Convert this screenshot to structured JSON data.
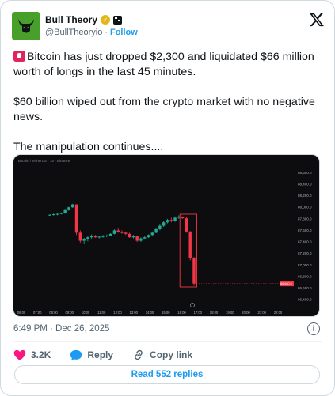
{
  "author": {
    "name": "Bull Theory",
    "handle": "@BullTheoryio",
    "separator": "·",
    "follow_label": "Follow"
  },
  "tweet": {
    "line1": "Bitcoin has just dropped $2,300 and liquidated $66 million worth of longs in the last 45 minutes.",
    "line2": "$60 billion wiped out from the crypto market with no negative news.",
    "line3": "The manipulation continues...."
  },
  "chart_data": {
    "type": "candlestick",
    "y_ticks": [
      "88,600.0",
      "88,400.0",
      "88,200.0",
      "88,000.0",
      "87,800.0",
      "87,600.0",
      "87,400.0",
      "87,200.0",
      "87,000.0",
      "86,800.0",
      "86,600.0",
      "86,400.0"
    ],
    "x_ticks": [
      "06:00",
      "07:00",
      "08:00",
      "09:00",
      "10:00",
      "11:00",
      "12:00",
      "13:00",
      "14:00",
      "15:00",
      "16:00",
      "17:00",
      "18:00",
      "19:00",
      "20:00",
      "21:00",
      "22:00"
    ],
    "candles": [
      [
        87860,
        87880,
        87850,
        87870
      ],
      [
        87870,
        87890,
        87855,
        87880
      ],
      [
        87880,
        87895,
        87860,
        87885
      ],
      [
        87885,
        87910,
        87875,
        87905
      ],
      [
        87905,
        87960,
        87890,
        87950
      ],
      [
        87950,
        88010,
        87940,
        88000
      ],
      [
        88000,
        88060,
        87990,
        88050
      ],
      [
        88050,
        88010,
        87520,
        87560
      ],
      [
        87560,
        87600,
        87380,
        87420
      ],
      [
        87420,
        87470,
        87360,
        87450
      ],
      [
        87450,
        87500,
        87410,
        87480
      ],
      [
        87480,
        87530,
        87450,
        87500
      ],
      [
        87500,
        87520,
        87470,
        87480
      ],
      [
        87480,
        87510,
        87460,
        87490
      ],
      [
        87490,
        87520,
        87470,
        87500
      ],
      [
        87500,
        87530,
        87480,
        87510
      ],
      [
        87510,
        87550,
        87500,
        87540
      ],
      [
        87540,
        87620,
        87530,
        87600
      ],
      [
        87600,
        87640,
        87560,
        87570
      ],
      [
        87570,
        87600,
        87540,
        87560
      ],
      [
        87560,
        87580,
        87520,
        87540
      ],
      [
        87540,
        87560,
        87470,
        87480
      ],
      [
        87480,
        87520,
        87460,
        87500
      ],
      [
        87500,
        87490,
        87400,
        87420
      ],
      [
        87420,
        87480,
        87400,
        87460
      ],
      [
        87460,
        87500,
        87440,
        87480
      ],
      [
        87480,
        87530,
        87470,
        87520
      ],
      [
        87520,
        87580,
        87500,
        87560
      ],
      [
        87560,
        87640,
        87550,
        87620
      ],
      [
        87620,
        87700,
        87600,
        87680
      ],
      [
        87680,
        87760,
        87660,
        87740
      ],
      [
        87740,
        87800,
        87720,
        87780
      ],
      [
        87780,
        87820,
        87740,
        87760
      ],
      [
        87760,
        87840,
        87750,
        87820
      ],
      [
        87820,
        87860,
        87800,
        87840
      ],
      [
        87840,
        87830,
        87800,
        87810
      ],
      [
        87810,
        87840,
        87560,
        87580
      ],
      [
        87580,
        87590,
        87080,
        87120
      ],
      [
        87120,
        87140,
        86640,
        86680
      ]
    ],
    "price_label": "86,680.0",
    "series_label": "Bitcoin / TetherUS · 15 · Binance"
  },
  "footer": {
    "timestamp": "6:49 PM · Dec 26, 2025",
    "likes": "3.2K",
    "reply_label": "Reply",
    "copy_label": "Copy link",
    "read_replies": "Read 552 replies"
  },
  "colors": {
    "accent": "#1d9bf0",
    "bull_green": "#22ab94",
    "bear_red": "#f23645",
    "chart_bg": "#0d0d10"
  }
}
